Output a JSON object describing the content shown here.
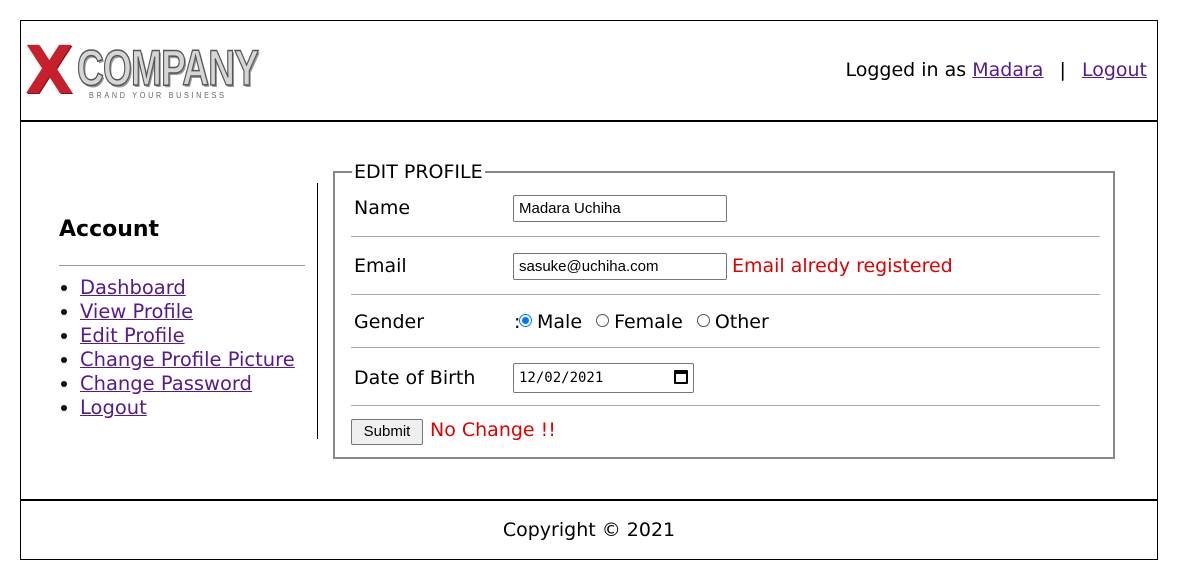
{
  "header": {
    "logo_x": "X",
    "logo_company": "COMPANY",
    "logo_tagline": "BRAND YOUR BUSINESS",
    "logged_in_prefix": "Logged in as",
    "username": "Madara",
    "separator": "|",
    "logout": "Logout"
  },
  "sidebar": {
    "title": "Account",
    "items": [
      {
        "label": "Dashboard"
      },
      {
        "label": "View Profile"
      },
      {
        "label": "Edit Profile"
      },
      {
        "label": "Change Profile Picture"
      },
      {
        "label": "Change Password"
      },
      {
        "label": "Logout"
      }
    ]
  },
  "form": {
    "legend": "EDIT PROFILE",
    "colon": ":",
    "name": {
      "label": "Name",
      "value": "Madara Uchiha"
    },
    "email": {
      "label": "Email",
      "value": "sasuke@uchiha.com",
      "error": "Email alredy registered"
    },
    "gender": {
      "label": "Gender",
      "options": [
        {
          "label": "Male",
          "checked": true
        },
        {
          "label": "Female",
          "checked": false
        },
        {
          "label": "Other",
          "checked": false
        }
      ]
    },
    "dob": {
      "label": "Date of Birth",
      "value": "12/02/2021"
    },
    "submit": "Submit",
    "status": "No Change !!"
  },
  "footer": {
    "copyright": "Copyright © 2021"
  },
  "colors": {
    "error": "#e00000",
    "link": "#551a8b",
    "brand": "#c8202a",
    "radio_accent": "#0075ff"
  }
}
